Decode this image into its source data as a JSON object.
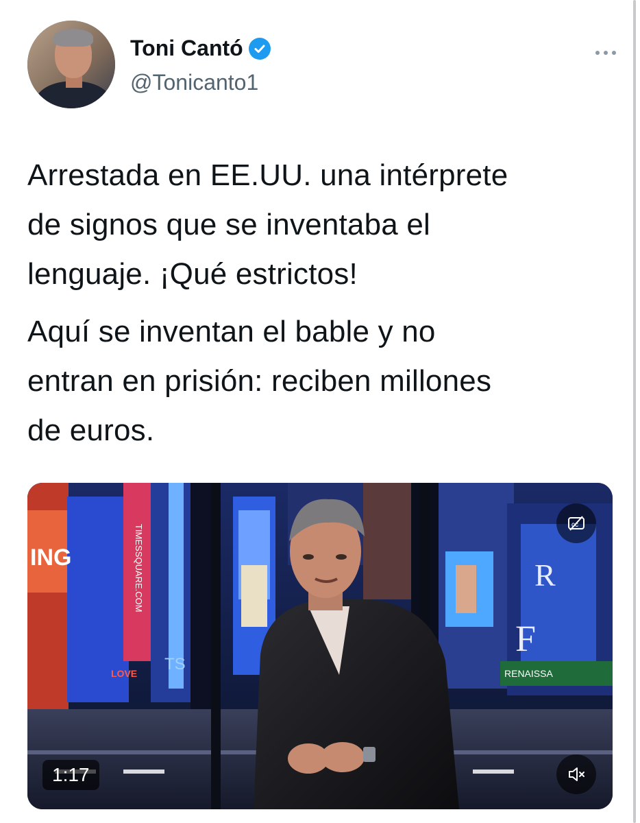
{
  "author": {
    "name": "Toni Cantó",
    "handle": "@Tonicanto1",
    "verified": true,
    "verified_color": "#1d9bf0"
  },
  "tweet": {
    "paragraphs": [
      "Arrestada en EE.UU. una intérprete\nde signos que se inventaba el\nlenguaje. ¡Qué estrictos!",
      "Aquí se inventan el bable y no\nentran en prisión: reciben millones\nde euros."
    ]
  },
  "media": {
    "type": "video",
    "duration": "1:17",
    "icons": {
      "captions": "closed-captions-off-icon",
      "mute": "volume-muted-icon"
    },
    "scene_texts": [
      "ING",
      "TIMESSQUARE.COM",
      "R",
      "F",
      "RENAISSA",
      "TS",
      "LOVE"
    ]
  },
  "colors": {
    "text": "#0f1419",
    "secondary": "#536471",
    "background": "#ffffff"
  }
}
